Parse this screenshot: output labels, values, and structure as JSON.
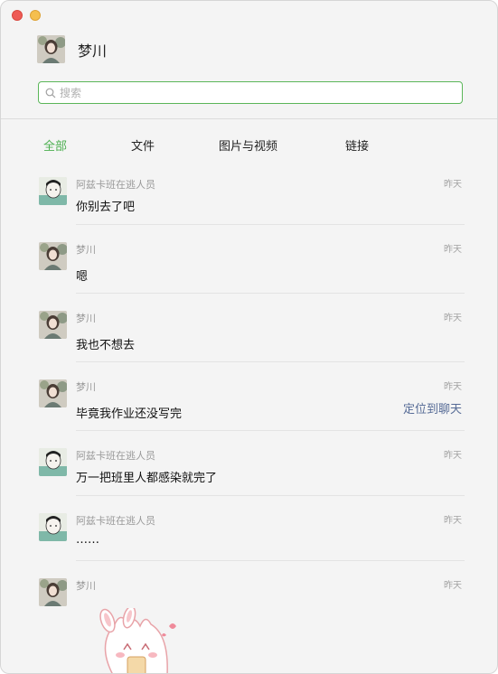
{
  "window": {
    "controls": [
      "close",
      "minimize"
    ]
  },
  "header": {
    "name": "梦川",
    "avatar_icon": "girl-portrait-avatar"
  },
  "search": {
    "placeholder": "搜索",
    "value": ""
  },
  "tabs": [
    {
      "label": "全部",
      "active": true
    },
    {
      "label": "文件",
      "active": false
    },
    {
      "label": "图片与视频",
      "active": false
    },
    {
      "label": "链接",
      "active": false
    }
  ],
  "messages": [
    {
      "sender": "阿兹卡班在逃人员",
      "time": "昨天",
      "content": "你别去了吧",
      "avatar_icon": "cartoon-boy-avatar"
    },
    {
      "sender": "梦川",
      "time": "昨天",
      "content": "嗯",
      "avatar_icon": "girl-portrait-avatar"
    },
    {
      "sender": "梦川",
      "time": "昨天",
      "content": "我也不想去",
      "avatar_icon": "girl-portrait-avatar"
    },
    {
      "sender": "梦川",
      "time": "昨天",
      "content": "毕竟我作业还没写完",
      "avatar_icon": "girl-portrait-avatar",
      "action": "定位到聊天"
    },
    {
      "sender": "阿兹卡班在逃人员",
      "time": "昨天",
      "content": "万一把班里人都感染就完了",
      "avatar_icon": "cartoon-boy-avatar"
    },
    {
      "sender": "阿兹卡班在逃人员",
      "time": "昨天",
      "content": "……",
      "avatar_icon": "cartoon-boy-avatar"
    },
    {
      "sender": "梦川",
      "time": "昨天",
      "content": "",
      "avatar_icon": "girl-portrait-avatar",
      "sticker": "pink-bunny-sticker"
    }
  ],
  "colors": {
    "accent_green": "#4caf50",
    "search_border": "#5bb659",
    "link_blue": "#566b96"
  }
}
